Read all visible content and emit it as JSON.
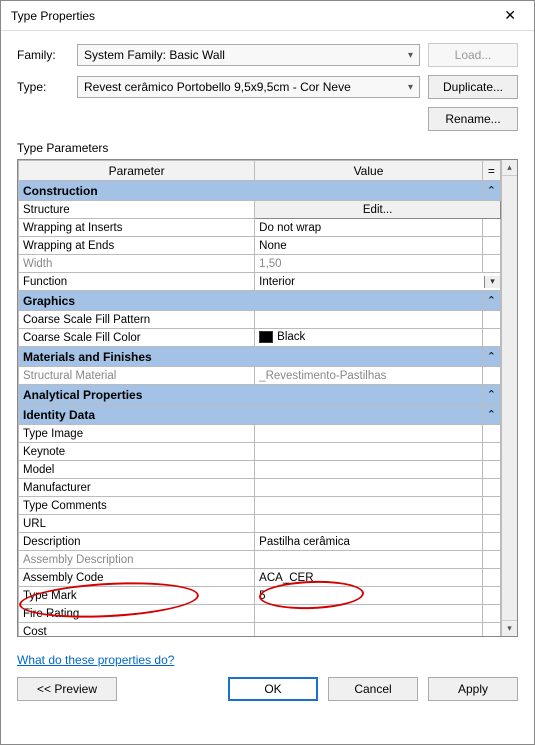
{
  "window": {
    "title": "Type Properties"
  },
  "header": {
    "family_label": "Family:",
    "family_value": "System Family: Basic Wall",
    "type_label": "Type:",
    "type_value": "Revest cerâmico Portobello 9,5x9,5cm - Cor Neve",
    "load_btn": "Load...",
    "duplicate_btn": "Duplicate...",
    "rename_btn": "Rename..."
  },
  "table": {
    "section_label": "Type Parameters",
    "col_param": "Parameter",
    "col_value": "Value",
    "col_eq": "=",
    "groups": {
      "construction": "Construction",
      "graphics": "Graphics",
      "materials": "Materials and Finishes",
      "analytical": "Analytical Properties",
      "identity": "Identity Data"
    },
    "rows": {
      "structure": {
        "label": "Structure",
        "value": "Edit..."
      },
      "wrap_inserts": {
        "label": "Wrapping at Inserts",
        "value": "Do not wrap"
      },
      "wrap_ends": {
        "label": "Wrapping at Ends",
        "value": "None"
      },
      "width": {
        "label": "Width",
        "value": "1,50"
      },
      "function": {
        "label": "Function",
        "value": "Interior"
      },
      "coarse_pattern": {
        "label": "Coarse Scale Fill Pattern",
        "value": ""
      },
      "coarse_color": {
        "label": "Coarse Scale Fill Color",
        "value": "Black"
      },
      "struct_material": {
        "label": "Structural Material",
        "value": "_Revestimento-Pastilhas"
      },
      "type_image": {
        "label": "Type Image",
        "value": ""
      },
      "keynote": {
        "label": "Keynote",
        "value": ""
      },
      "model": {
        "label": "Model",
        "value": ""
      },
      "manufacturer": {
        "label": "Manufacturer",
        "value": ""
      },
      "type_comments": {
        "label": "Type Comments",
        "value": ""
      },
      "url": {
        "label": "URL",
        "value": ""
      },
      "description": {
        "label": "Description",
        "value": "Pastilha cerâmica"
      },
      "assembly_desc": {
        "label": "Assembly Description",
        "value": ""
      },
      "assembly_code": {
        "label": "Assembly Code",
        "value": "ACA_CER"
      },
      "type_mark": {
        "label": "Type Mark",
        "value": "5"
      },
      "fire_rating": {
        "label": "Fire Rating",
        "value": ""
      },
      "cost": {
        "label": "Cost",
        "value": ""
      }
    }
  },
  "footer": {
    "help_link": "What do these properties do?",
    "preview_btn": "<< Preview",
    "ok_btn": "OK",
    "cancel_btn": "Cancel",
    "apply_btn": "Apply"
  }
}
